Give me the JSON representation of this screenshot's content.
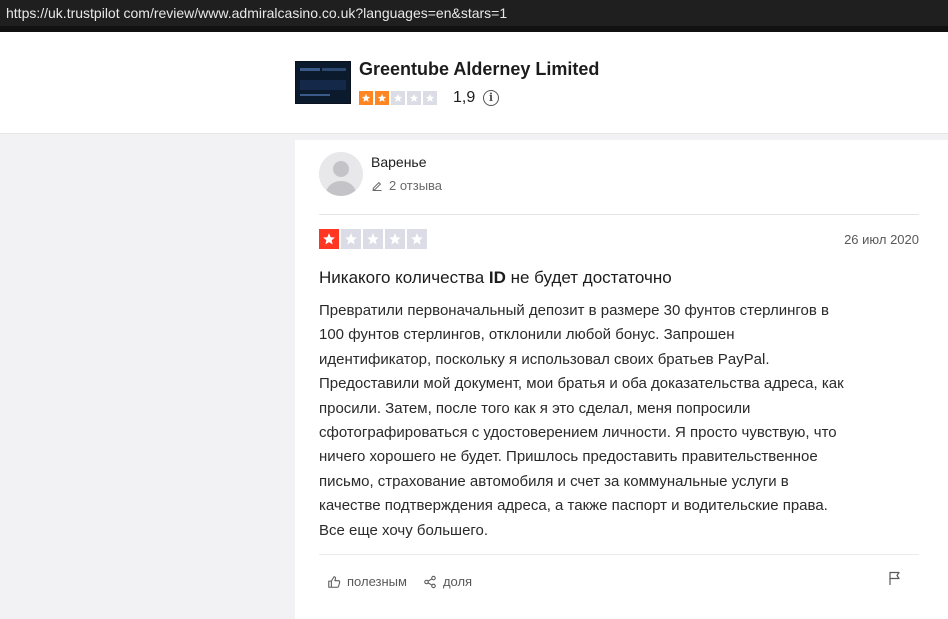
{
  "browser": {
    "url": "https://uk.trustpilot com/review/www.admiralcasino.co.uk?languages=en&stars=1"
  },
  "company": {
    "name": "Greentube Alderney Limited",
    "rating_stars": 2,
    "rating_stars_total": 5,
    "score": "1,9",
    "info_icon": "info-icon"
  },
  "review": {
    "reviewer_name": "Варенье",
    "reviews_count": "2 отзыва",
    "stars": 1,
    "stars_total": 5,
    "date": "26 июл 2020",
    "title_before": "Никакого количества ",
    "title_bold": "ID",
    "title_after": " не будет достаточно",
    "body_lines": [
      "Превратили первоначальный депозит в размере 30 фунтов стерлингов в",
      "100 фунтов стерлингов, отклонили любой бонус. Запрошен",
      "идентификатор, поскольку я использовал своих братьев PayPal.",
      "Предоставили мой документ, мои братья и оба доказательства адреса, как",
      "просили. Затем, после того как я это сделал, меня попросили",
      "сфотографироваться с удостоверением личности. Я просто чувствую, что",
      "ничего хорошего не будет. Пришлось предоставить правительственное",
      "письмо, страхование автомобиля и счет за коммунальные услуги в",
      "качестве подтверждения адреса, а также паспорт и водительские права.",
      "Все еще хочу большего."
    ],
    "useful_label": "полезным",
    "share_label": "доля"
  },
  "colors": {
    "company_star": "#ff8622",
    "review_star": "#ff3722",
    "star_empty": "#dcdce6"
  }
}
